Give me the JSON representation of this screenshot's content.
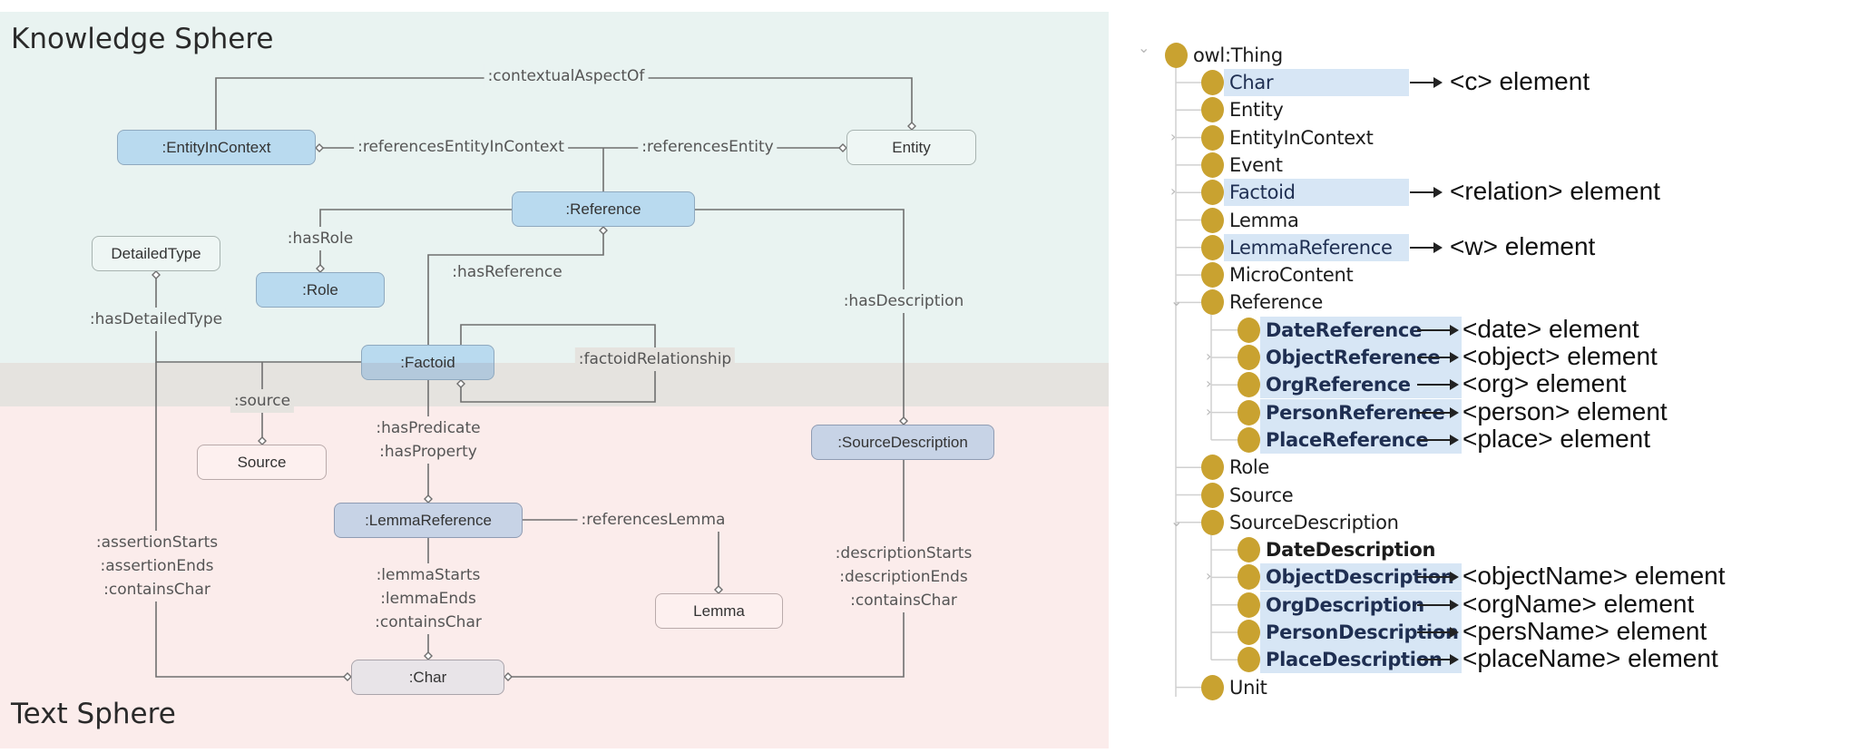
{
  "diagram": {
    "spheres": {
      "knowledge": "Knowledge Sphere",
      "text": "Text Sphere"
    },
    "colors": {
      "knowledge_bg": "#e9f3f1",
      "boundary_bg": "#e5e3df",
      "text_bg": "#fbeceb",
      "class_blue": "#b9daef",
      "class_lavender": "#c7d3e6",
      "class_gray": "#e8e4e8",
      "edge": "#6f6f6f"
    },
    "nodes": {
      "entity_in_context": ":EntityInContext",
      "entity": "Entity",
      "reference": ":Reference",
      "detailed_type": "DetailedType",
      "role": ":Role",
      "factoid": ":Factoid",
      "source": "Source",
      "source_description": ":SourceDescription",
      "lemma_reference": ":LemmaReference",
      "lemma": "Lemma",
      "char": ":Char"
    },
    "edges": {
      "contextual_aspect_of": ":contextualAspectOf",
      "references_entity_in_context": ":referencesEntityInContext",
      "references_entity": ":referencesEntity",
      "has_role": ":hasRole",
      "has_reference": ":hasReference",
      "has_description": ":hasDescription",
      "has_detailed_type": ":hasDetailedType",
      "factoid_relationship": ":factoidRelationship",
      "source": ":source",
      "has_predicate": ":hasPredicate",
      "has_property": ":hasProperty",
      "references_lemma": ":referencesLemma",
      "assertion_starts": ":assertionStarts",
      "assertion_ends": ":assertionEnds",
      "assertion_contains_char": ":containsChar",
      "lemma_starts": ":lemmaStarts",
      "lemma_ends": ":lemmaEnds",
      "lemma_contains_char": ":containsChar",
      "description_starts": ":descriptionStarts",
      "description_ends": ":descriptionEnds",
      "description_contains_char": ":containsChar"
    }
  },
  "tree": {
    "root": "owl:Thing",
    "items": [
      {
        "label": "Char",
        "highlight": true,
        "bold": false,
        "mapping": "<c> element"
      },
      {
        "label": "Entity",
        "highlight": false,
        "bold": false,
        "mapping": ""
      },
      {
        "label": "EntityInContext",
        "highlight": false,
        "bold": false,
        "mapping": "",
        "expandable": true
      },
      {
        "label": "Event",
        "highlight": false,
        "bold": false,
        "mapping": ""
      },
      {
        "label": "Factoid",
        "highlight": true,
        "bold": false,
        "mapping": "<relation> element",
        "expandable": true
      },
      {
        "label": "Lemma",
        "highlight": false,
        "bold": false,
        "mapping": ""
      },
      {
        "label": "LemmaReference",
        "highlight": true,
        "bold": false,
        "mapping": "<w> element"
      },
      {
        "label": "MicroContent",
        "highlight": false,
        "bold": false,
        "mapping": ""
      },
      {
        "label": "Reference",
        "highlight": false,
        "bold": false,
        "mapping": "",
        "expanded": true
      },
      {
        "label": "DateReference",
        "highlight": true,
        "bold": true,
        "mapping": "<date> element",
        "child": true
      },
      {
        "label": "ObjectReference",
        "highlight": true,
        "bold": true,
        "mapping": "<object> element",
        "child": true,
        "expandable": true
      },
      {
        "label": "OrgReference",
        "highlight": true,
        "bold": true,
        "mapping": "<org> element",
        "child": true,
        "expandable": true
      },
      {
        "label": "PersonReference",
        "highlight": true,
        "bold": true,
        "mapping": "<person> element",
        "child": true,
        "expandable": true
      },
      {
        "label": "PlaceReference",
        "highlight": true,
        "bold": true,
        "mapping": "<place> element",
        "child": true
      },
      {
        "label": "Role",
        "highlight": false,
        "bold": false,
        "mapping": ""
      },
      {
        "label": "Source",
        "highlight": false,
        "bold": false,
        "mapping": ""
      },
      {
        "label": "SourceDescription",
        "highlight": false,
        "bold": false,
        "mapping": "",
        "expanded": true
      },
      {
        "label": "DateDescription",
        "highlight": false,
        "bold": true,
        "mapping": "",
        "child": true
      },
      {
        "label": "ObjectDescription",
        "highlight": true,
        "bold": true,
        "mapping": "<objectName> element",
        "child": true,
        "expandable": true
      },
      {
        "label": "OrgDescription",
        "highlight": true,
        "bold": true,
        "mapping": "<orgName> element",
        "child": true
      },
      {
        "label": "PersonDescription",
        "highlight": true,
        "bold": true,
        "mapping": "<persName> element",
        "child": true
      },
      {
        "label": "PlaceDescription",
        "highlight": true,
        "bold": true,
        "mapping": "<placeName> element",
        "child": true
      },
      {
        "label": "Unit",
        "highlight": false,
        "bold": false,
        "mapping": ""
      }
    ],
    "colors": {
      "bullet": "#c9a230",
      "highlight": "#d7e6f5"
    }
  }
}
